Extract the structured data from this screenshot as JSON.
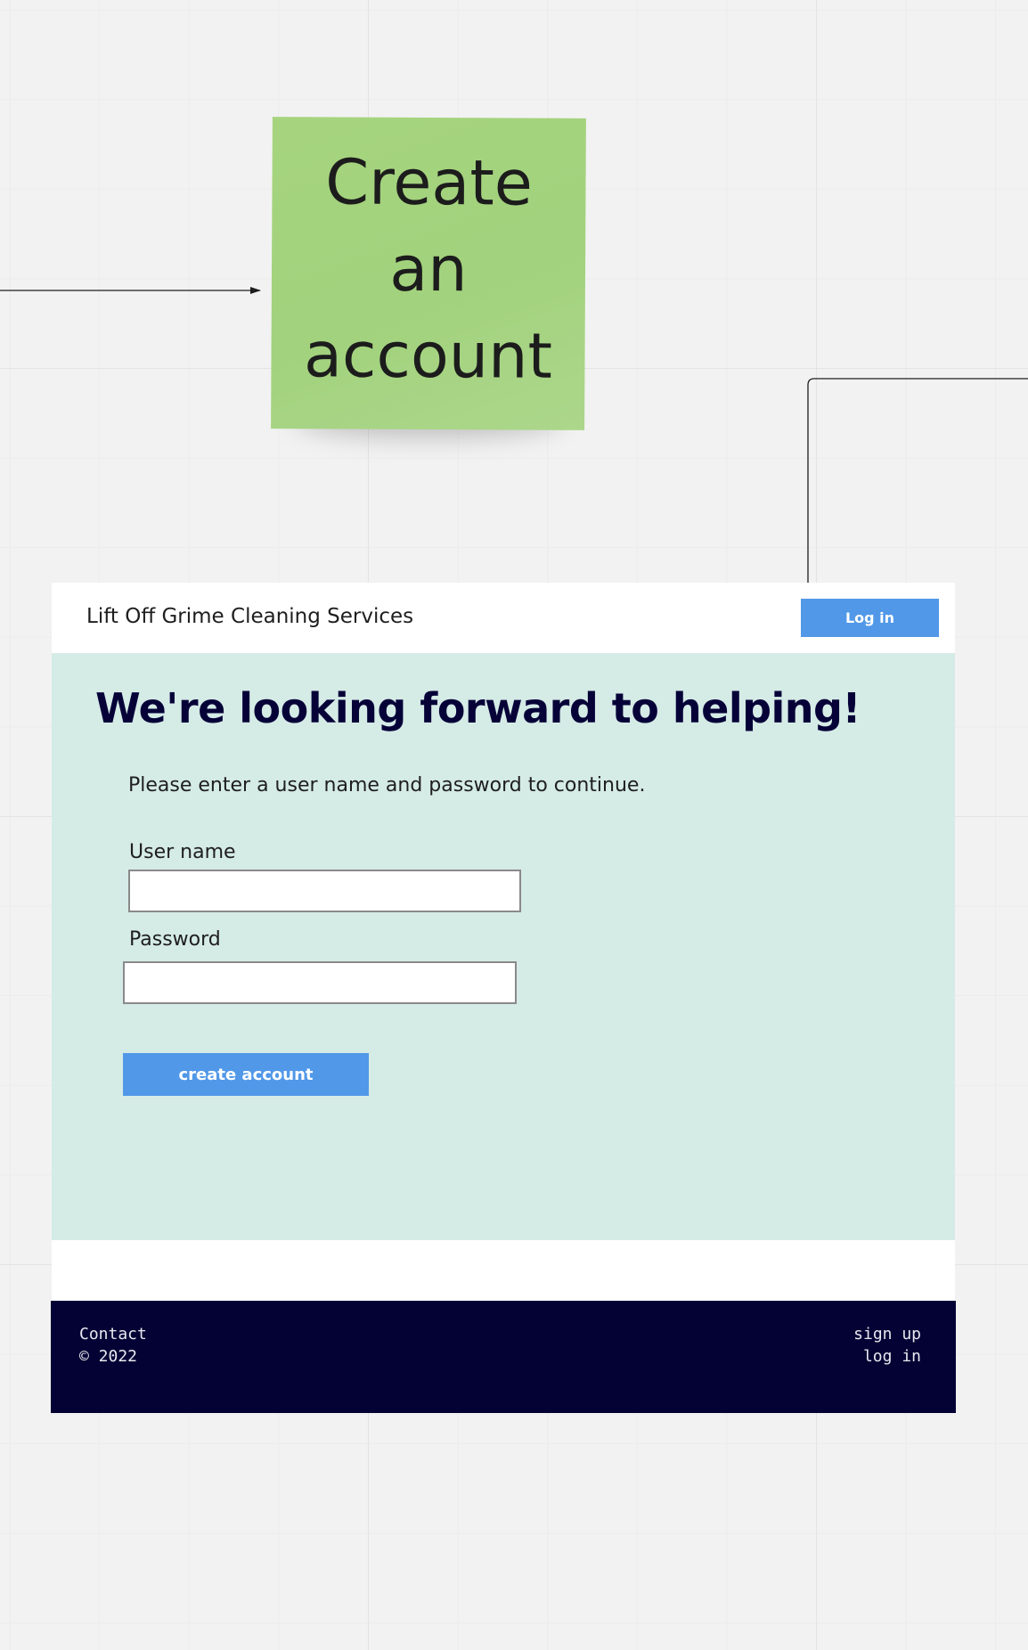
{
  "canvas": {
    "background": "#f2f2f2"
  },
  "sticky_note": {
    "text": "Create an account",
    "color": "#a6d47e"
  },
  "page": {
    "header": {
      "site_title": "Lift Off Grime Cleaning Services",
      "login_label": "Log in"
    },
    "main": {
      "heading": "We're looking forward to helping!",
      "instructions": "Please enter a user name and password to continue.",
      "username_label": "User name",
      "username_value": "",
      "password_label": "Password",
      "password_value": "",
      "create_account_label": "create account",
      "background": "#d5ebe6"
    },
    "footer": {
      "contact_label": "Contact",
      "copyright": "© 2022",
      "sign_up_label": "sign up",
      "log_in_label": "log in",
      "background": "#040234"
    },
    "accent_color": "#5198e8"
  }
}
